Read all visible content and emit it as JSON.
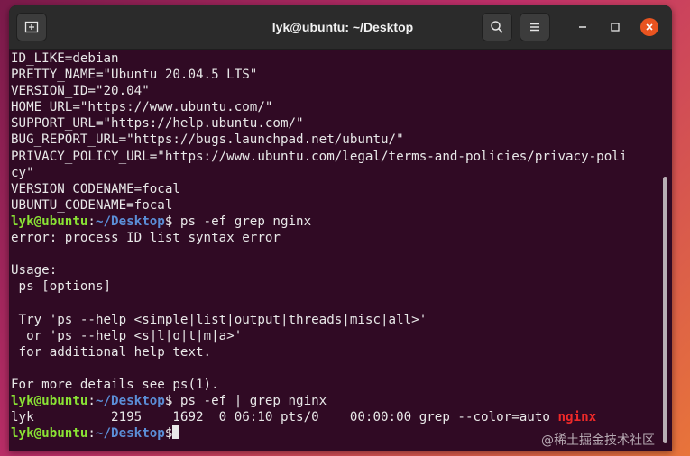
{
  "window": {
    "title": "lyk@ubuntu: ~/Desktop"
  },
  "colors": {
    "terminal_bg": "#300a24",
    "prompt_user": "#8ae234",
    "prompt_path": "#5b8dd6",
    "highlight": "#ef2929",
    "close": "#e95420"
  },
  "icons": {
    "new_tab": "new-tab-icon",
    "search": "search-icon",
    "menu": "hamburger-menu-icon",
    "minimize": "minimize-icon",
    "maximize": "maximize-icon",
    "close": "close-icon"
  },
  "terminal": {
    "lines": [
      "ID_LIKE=debian",
      "PRETTY_NAME=\"Ubuntu 20.04.5 LTS\"",
      "VERSION_ID=\"20.04\"",
      "HOME_URL=\"https://www.ubuntu.com/\"",
      "SUPPORT_URL=\"https://help.ubuntu.com/\"",
      "BUG_REPORT_URL=\"https://bugs.launchpad.net/ubuntu/\"",
      "PRIVACY_POLICY_URL=\"https://www.ubuntu.com/legal/terms-and-policies/privacy-poli",
      "cy\"",
      "VERSION_CODENAME=focal",
      "UBUNTU_CODENAME=focal"
    ],
    "prompt1": {
      "user": "lyk@ubuntu",
      "path": "~/Desktop",
      "command": " ps -ef grep nginx"
    },
    "output1": [
      "error: process ID list syntax error",
      "",
      "Usage:",
      " ps [options]",
      "",
      " Try 'ps --help <simple|list|output|threads|misc|all>'",
      "  or 'ps --help <s|l|o|t|m|a>'",
      " for additional help text.",
      "",
      "For more details see ps(1)."
    ],
    "prompt2": {
      "user": "lyk@ubuntu",
      "path": "~/Desktop",
      "command": " ps -ef | grep nginx"
    },
    "result_line": {
      "text": "lyk          2195    1692  0 06:10 pts/0    00:00:00 grep --color=auto ",
      "match": "nginx"
    },
    "prompt3": {
      "user": "lyk@ubuntu",
      "path": "~/Desktop"
    },
    "prompt_sep": ":",
    "prompt_end": "$"
  },
  "watermark": "@稀土掘金技术社区"
}
